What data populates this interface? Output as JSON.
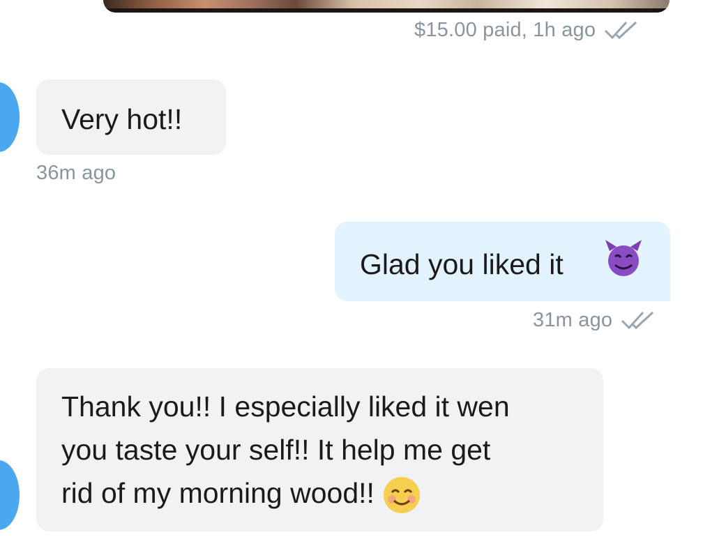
{
  "paid_message": {
    "meta": "$15.00 paid, 1h ago"
  },
  "messages": [
    {
      "direction": "incoming",
      "text": "Very hot!!",
      "time": "36m ago"
    },
    {
      "direction": "outgoing",
      "text": "Glad you liked it",
      "emoji": "smiling-imp-icon",
      "time": "31m ago"
    },
    {
      "direction": "incoming",
      "lines": [
        "Thank you!! I especially liked it wen",
        "you taste your self!! It help me get",
        "rid of my morning wood!!"
      ],
      "emoji": "blush-smile-icon"
    }
  ],
  "colors": {
    "incoming_bubble": "#f1f2f4",
    "outgoing_bubble": "#e3f3fd",
    "avatar": "#4ba8ee",
    "meta_text": "#8a94a0",
    "checkmark": "#9aa3ad"
  }
}
